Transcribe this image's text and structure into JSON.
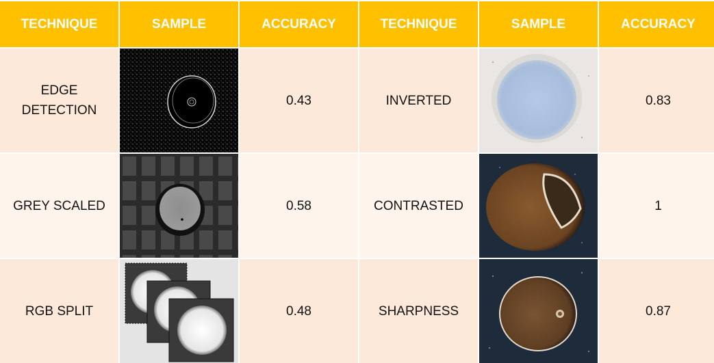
{
  "header": [
    "TECHNIQUE",
    "SAMPLE",
    "ACCURACY",
    "TECHNIQUE",
    "SAMPLE",
    "ACCURACY"
  ],
  "rows": [
    {
      "left": {
        "technique": "EDGE\nDETECTION",
        "sample_icon": "edge-detection-image",
        "accuracy": "0.43"
      },
      "right": {
        "technique": "INVERTED",
        "sample_icon": "inverted-image",
        "accuracy": "0.83"
      }
    },
    {
      "left": {
        "technique": "GREY SCALED",
        "sample_icon": "grey-scaled-image",
        "accuracy": "0.58"
      },
      "right": {
        "technique": "CONTRASTED",
        "sample_icon": "contrasted-image",
        "accuracy": "1"
      }
    },
    {
      "left": {
        "technique": "RGB SPLIT",
        "sample_icon": "rgb-split-image",
        "accuracy": "0.48"
      },
      "right": {
        "technique": "SHARPNESS",
        "sample_icon": "sharpness-image",
        "accuracy": "0.87"
      }
    }
  ],
  "colors": {
    "header_bg": "#FFC000",
    "header_text": "#FFFFFF",
    "row_odd": "#FDE9D9",
    "row_even": "#FEF4EC"
  }
}
